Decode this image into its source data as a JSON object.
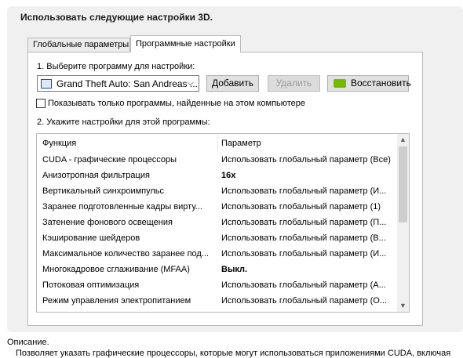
{
  "heading": "Использовать следующие настройки 3D.",
  "tabs": [
    {
      "label": "Глобальные параметры"
    },
    {
      "label": "Программные настройки"
    }
  ],
  "step1_label": "1. Выберите программу для настройки:",
  "program_select": {
    "value": "Grand Theft Auto: San Andreas ..."
  },
  "buttons": {
    "add": "Добавить",
    "remove": "Удалить",
    "restore": "Восстановить"
  },
  "show_only_checkbox": {
    "label": "Показывать только программы, найденные на этом компьютере",
    "checked": false
  },
  "step2_label": "2. Укажите настройки для этой программы:",
  "table": {
    "columns": [
      "Функция",
      "Параметр"
    ],
    "rows": [
      {
        "feature": "CUDA - графические процессоры",
        "value": "Использовать глобальный параметр (Все)"
      },
      {
        "feature": "Анизотропная фильтрация",
        "value": "16x"
      },
      {
        "feature": "Вертикальный синхроимпульс",
        "value": "Использовать глобальный параметр (И..."
      },
      {
        "feature": "Заранее подготовленные кадры вирту...",
        "value": "Использовать глобальный параметр (1)"
      },
      {
        "feature": "Затенение фонового освещения",
        "value": "Использовать глобальный параметр (П..."
      },
      {
        "feature": "Кэширование шейдеров",
        "value": "Использовать глобальный параметр (В..."
      },
      {
        "feature": "Максимальное количество заранее под...",
        "value": "Использовать глобальный параметр (И..."
      },
      {
        "feature": "Многокадровое сглаживание (MFAA)",
        "value": "Выкл."
      },
      {
        "feature": "Потоковая оптимизация",
        "value": "Использовать глобальный параметр (А..."
      },
      {
        "feature": "Режим управления электропитанием",
        "value": "Использовать глобальный параметр (О..."
      }
    ]
  },
  "description": {
    "label": "Описание.",
    "text": "Позволяет указать графические процессоры, которые могут использоваться приложениями CUDA, включая"
  },
  "colors": {
    "panel_bg": "#f0f0f0",
    "nvidia_green": "#76b900"
  },
  "icons": {
    "program": "app-window-icon",
    "restore": "nvidia-logo-icon",
    "dropdown": "chevron-down-icon"
  }
}
